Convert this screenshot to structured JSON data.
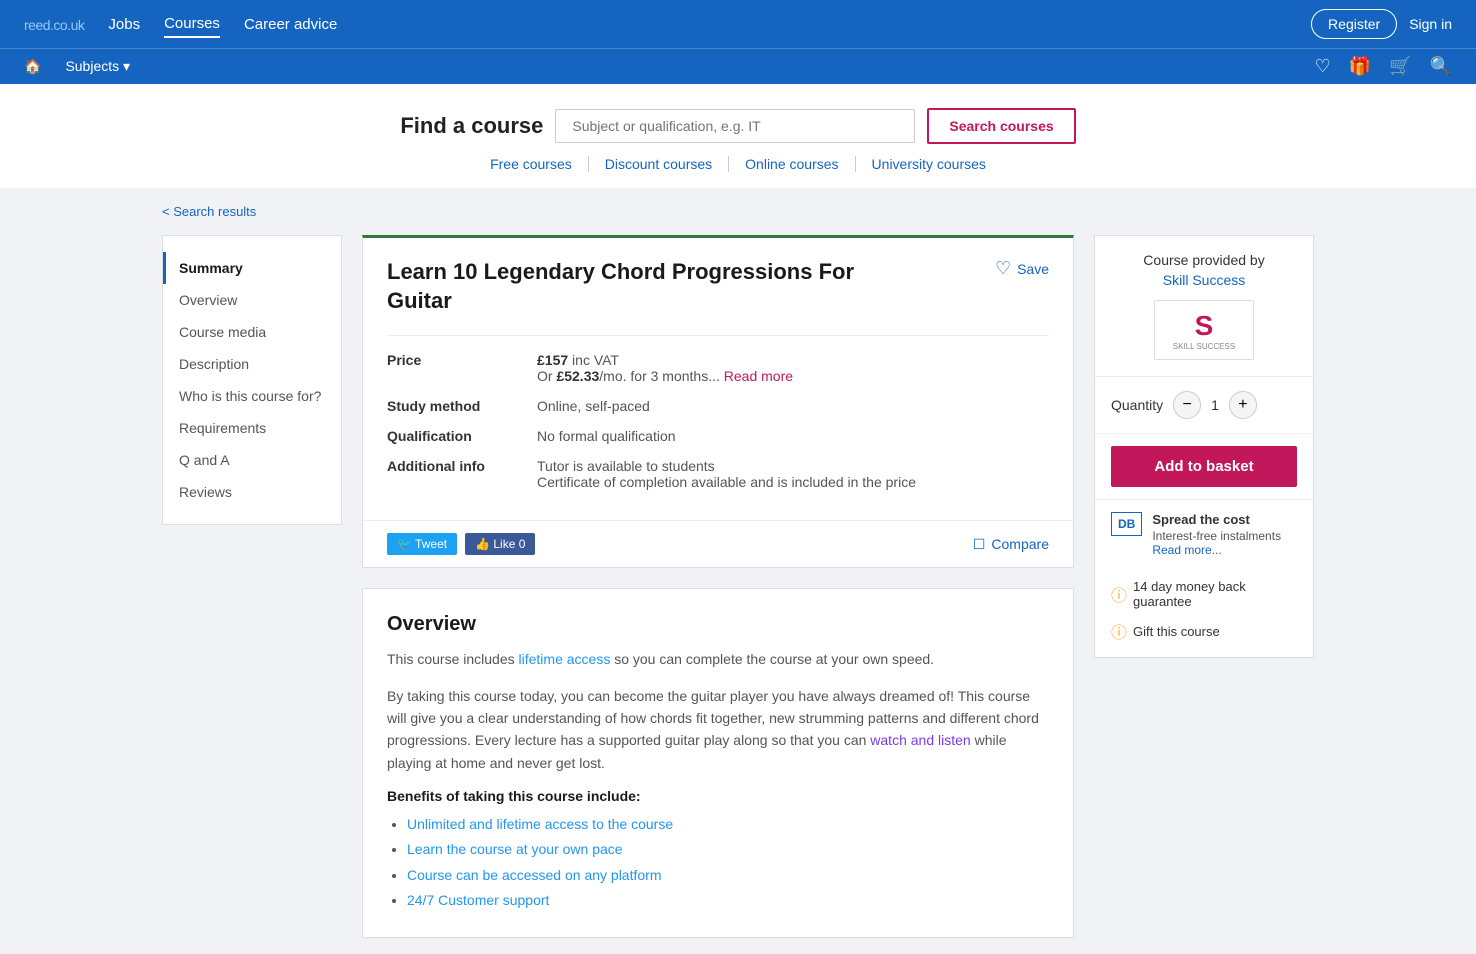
{
  "logo": {
    "brand": "reed",
    "suffix": ".co.uk"
  },
  "topnav": {
    "links": [
      {
        "label": "Jobs",
        "active": false
      },
      {
        "label": "Courses",
        "active": true
      },
      {
        "label": "Career advice",
        "active": false
      }
    ],
    "register_label": "Register",
    "signin_label": "Sign in"
  },
  "secnav": {
    "home_label": "🏠",
    "subjects_label": "Subjects ▾"
  },
  "search": {
    "find_label": "Find a course",
    "input_placeholder": "Subject or qualification, e.g. IT",
    "button_label": "Search courses",
    "course_links": [
      {
        "label": "Free courses"
      },
      {
        "label": "Discount courses"
      },
      {
        "label": "Online courses"
      },
      {
        "label": "University courses"
      }
    ]
  },
  "back_link": "< Search results",
  "sidebar": {
    "items": [
      {
        "label": "Summary",
        "active": true
      },
      {
        "label": "Overview",
        "active": false
      },
      {
        "label": "Course media",
        "active": false
      },
      {
        "label": "Description",
        "active": false
      },
      {
        "label": "Who is this course for?",
        "active": false
      },
      {
        "label": "Requirements",
        "active": false
      },
      {
        "label": "Q and A",
        "active": false
      },
      {
        "label": "Reviews",
        "active": false
      }
    ]
  },
  "course": {
    "title": "Learn 10 Legendary Chord Progressions For Guitar",
    "save_label": "Save",
    "price": {
      "label": "Price",
      "amount": "£157",
      "vat_suffix": " inc VAT",
      "monthly_prefix": "Or ",
      "monthly_amount": "£52.33",
      "monthly_suffix": "/mo. for 3 months...",
      "read_more": "Read more"
    },
    "study_method": {
      "label": "Study method",
      "value": "Online, self-paced"
    },
    "qualification": {
      "label": "Qualification",
      "value": "No formal qualification"
    },
    "additional_info": {
      "label": "Additional info",
      "line1": "Tutor is available to students",
      "line2": "Certificate of completion available and is included in the price"
    },
    "social": {
      "tweet_label": "🐦 Tweet",
      "like_label": "👍 Like 0",
      "compare_label": "Compare"
    }
  },
  "overview": {
    "title": "Overview",
    "para1": "This course includes lifetime access so you can complete the course at your own speed.",
    "para2": "By taking this course today, you can become the guitar player you have always dreamed of! This course will give you a clear understanding of how chords fit together, new strumming patterns and different chord progressions. Every lecture has a supported guitar play along so that you can watch and listen while playing at home and never get lost.",
    "benefits_title": "Benefits of taking this course include:",
    "benefits": [
      "Unlimited and lifetime access to the course",
      "Learn the course at your own pace",
      "Course can be accessed on any platform",
      "24/7 Customer support"
    ]
  },
  "provider": {
    "header": "Course provided by",
    "name": "Skill Success",
    "logo_text": "S",
    "logo_label": "SKILL SUCCESS"
  },
  "purchase": {
    "quantity_label": "Quantity",
    "qty_minus": "−",
    "qty_value": "1",
    "qty_plus": "+",
    "add_basket_label": "Add to basket",
    "spread": {
      "badge": "DB",
      "title": "Spread the cost",
      "subtitle": "Interest-free instalments",
      "link": "Read more..."
    },
    "guarantee": "14 day money back guarantee",
    "gift": "Gift this course"
  }
}
